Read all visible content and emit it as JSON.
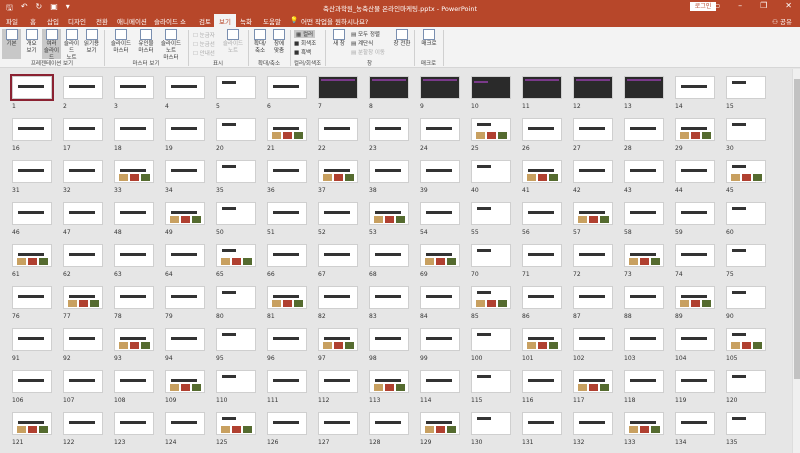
{
  "window": {
    "title": "축산과학원_농축산물 온라인마케팅.pptx  -  PowerPoint",
    "login": "로그인",
    "share": "공유"
  },
  "tabs": [
    "파일",
    "홈",
    "삽입",
    "디자인",
    "전환",
    "애니메이션",
    "슬라이드 쇼",
    "검토",
    "보기",
    "녹화",
    "도움말"
  ],
  "active_tab": "보기",
  "tell_me": "어떤 작업을 원하시나요?",
  "ribbon": {
    "presentation_views": {
      "label": "프레젠테이션 보기",
      "buttons": [
        "기본",
        "개요\n보기",
        "여러\n슬라이드",
        "슬라이드\n노트",
        "읽기용\n보기"
      ]
    },
    "master_views": {
      "label": "마스터 보기",
      "buttons": [
        "슬라이드\n마스터",
        "유인물\n마스터",
        "슬라이드 노트\n마스터"
      ]
    },
    "show": {
      "label": "표시",
      "checks": [
        "눈금자",
        "눈금선",
        "안내선"
      ],
      "notes": "슬라이드\n노트"
    },
    "zoom": {
      "label": "확대/축소",
      "buttons": [
        "확대/\n축소",
        "창에\n맞춤"
      ]
    },
    "color": {
      "label": "컬러/회색조",
      "options": [
        "컬러",
        "회색조",
        "흑백"
      ]
    },
    "window": {
      "label": "창",
      "new": "새 창",
      "items": [
        "모두 정렬",
        "계단식",
        "분할창 이동"
      ],
      "switch": "창 전환"
    },
    "macro": {
      "label": "매크로",
      "button": "매크로"
    }
  },
  "slides": {
    "count": 135,
    "selected": 1,
    "dark": [
      7,
      8,
      9,
      10,
      11,
      12,
      13
    ]
  }
}
